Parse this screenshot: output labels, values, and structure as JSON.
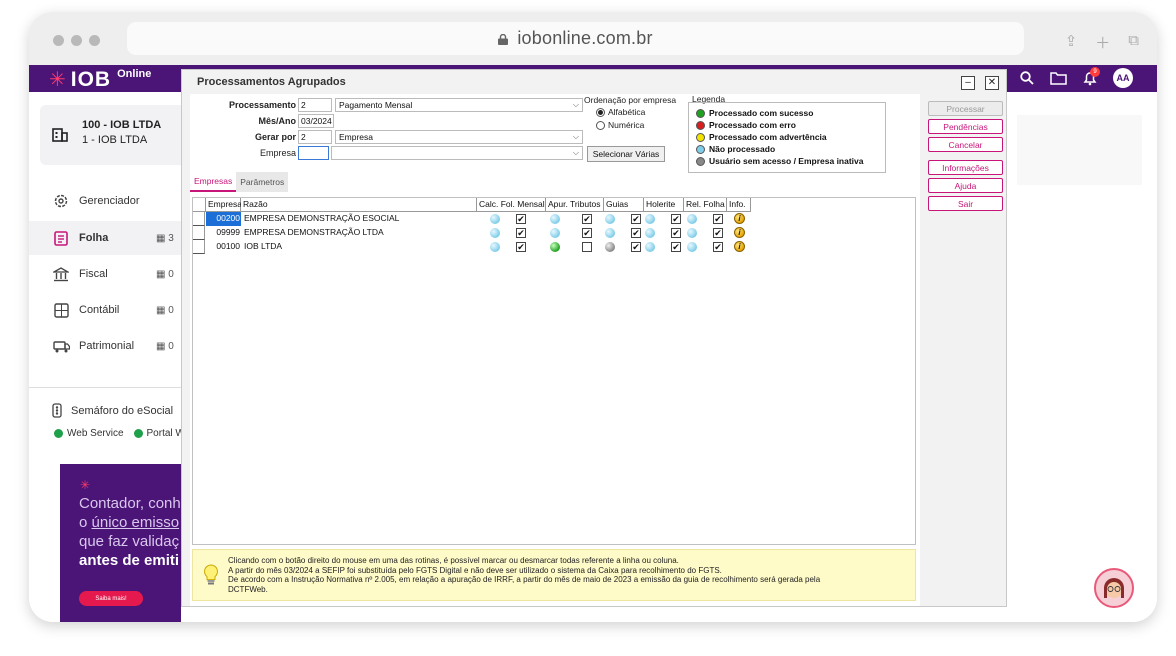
{
  "browser": {
    "url": "iobonline.com.br"
  },
  "app": {
    "logo": {
      "brand": "IOB",
      "product": "Online"
    },
    "topbar": {
      "notification_count": "9",
      "user_initials": "AA"
    }
  },
  "sidebar": {
    "company": {
      "line1": "100 - IOB LTDA",
      "line2": "1 - IOB LTDA"
    },
    "items": [
      {
        "label": "Gerenciador",
        "icon": "gear-icon",
        "date": ""
      },
      {
        "label": "Folha",
        "icon": "document-icon",
        "date": "3"
      },
      {
        "label": "Fiscal",
        "icon": "bank-icon",
        "date": "0"
      },
      {
        "label": "Contábil",
        "icon": "calculator-icon",
        "date": "0"
      },
      {
        "label": "Patrimonial",
        "icon": "truck-icon",
        "date": "0"
      }
    ],
    "semaforo": {
      "label": "Semáforo do eSocial",
      "statuses": [
        "Web Service",
        "Portal W"
      ]
    },
    "promo": {
      "line1": "Contador, conh",
      "line2_pre": "o ",
      "line2_link": "único emisso",
      "line3": "que faz validaç",
      "line4": "antes de emiti",
      "button": "Saiba mais!"
    }
  },
  "dialog": {
    "title": "Processamentos Agrupados",
    "form": {
      "processamento_label": "Processamento",
      "processamento_code": "2",
      "processamento_value": "Pagamento Mensal",
      "mesano_label": "Mês/Ano",
      "mesano_value": "03/2024",
      "gerar_label": "Gerar por",
      "gerar_code": "2",
      "gerar_value": "Empresa",
      "empresa_label": "Empresa",
      "empresa_code": "",
      "empresa_value": ""
    },
    "ordenacao": {
      "label": "Ordenação por empresa",
      "opt1": "Alfabética",
      "opt2": "Numérica",
      "selected": "Alfabética"
    },
    "selecionar_button": "Selecionar Várias",
    "legenda": {
      "title": "Legenda",
      "items": [
        {
          "label": "Processado com sucesso",
          "color": "#1fa01f"
        },
        {
          "label": "Processado com erro",
          "color": "#d62020"
        },
        {
          "label": "Processado com advertência",
          "color": "#f2e200"
        },
        {
          "label": "Não processado",
          "color": "#7fcde8"
        },
        {
          "label": "Usuário sem acesso / Empresa inativa",
          "color": "#888888"
        }
      ]
    },
    "tabs": [
      "Empresas",
      "Parâmetros"
    ],
    "grid": {
      "headers": [
        "Empresa",
        "Razão",
        "Calc. Fol. Mensal",
        "Apur. Tributos",
        "Guias",
        "Holerite",
        "Rel. Folha",
        "Info."
      ],
      "rows": [
        {
          "code": "00200",
          "name": "EMPRESA DEMONSTRAÇÃO ESOCIAL",
          "status": [
            "blue",
            "blue",
            "blue",
            "blue",
            "blue"
          ],
          "checks": [
            true,
            true,
            true,
            true,
            true
          ],
          "selected": true
        },
        {
          "code": "09999",
          "name": "EMPRESA DEMONSTRAÇÃO LTDA",
          "status": [
            "blue",
            "blue",
            "blue",
            "blue",
            "blue"
          ],
          "checks": [
            true,
            true,
            true,
            true,
            true
          ],
          "selected": false
        },
        {
          "code": "00100",
          "name": "IOB LTDA",
          "status": [
            "blue",
            "green",
            "gray",
            "blue",
            "blue"
          ],
          "checks": [
            true,
            false,
            true,
            true,
            true
          ],
          "selected": false
        }
      ]
    },
    "hint": {
      "line1": "Clicando com o botão direito do mouse em uma das rotinas, é possível marcar ou desmarcar todas referente a linha ou coluna.",
      "line2": "A partir do mês 03/2024 a SEFIP foi substituída pelo FGTS Digital e não deve ser utilizado o sistema da Caixa para recolhimento do FGTS.",
      "line3": "De acordo com a Instrução Normativa nº 2.005, em relação a apuração de IRRF, a partir do mês de maio de 2023 a emissão da guia de recolhimento será gerada pela",
      "line4": "DCTFWeb."
    },
    "buttons": {
      "processar": "Processar",
      "pendencias": "Pendências",
      "cancelar": "Cancelar",
      "informacoes": "Informações",
      "ajuda": "Ajuda",
      "sair": "Sair"
    }
  }
}
